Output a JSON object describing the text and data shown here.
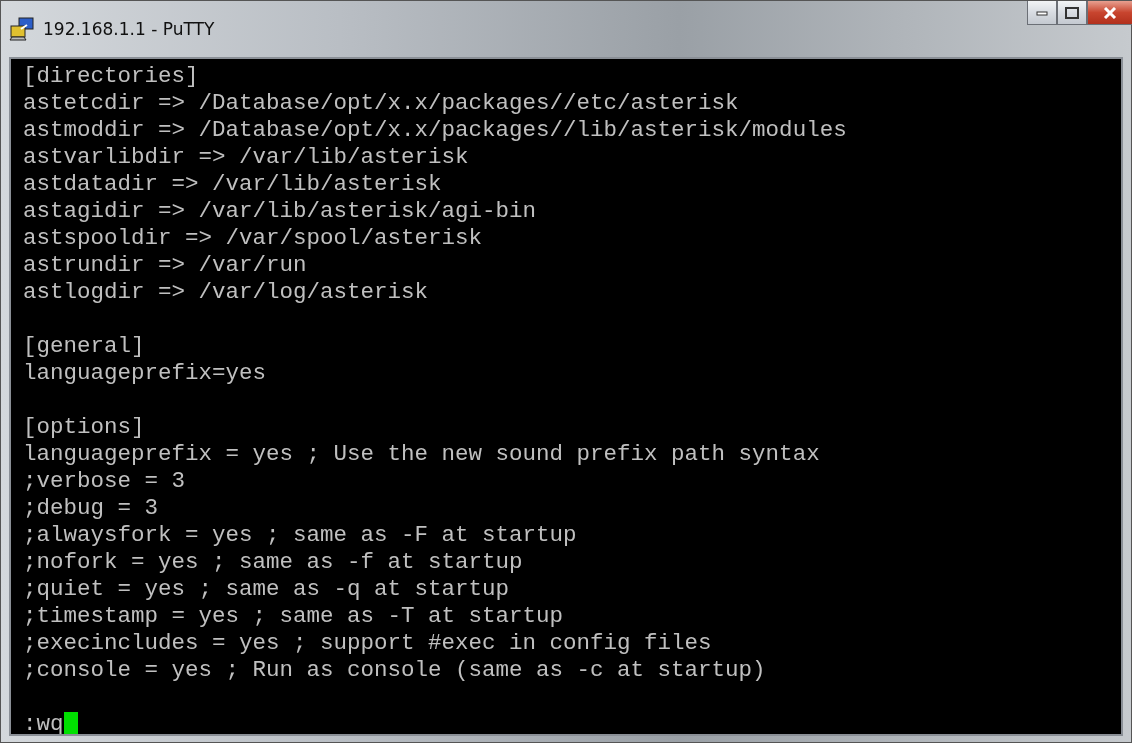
{
  "window": {
    "title": "192.168.1.1 - PuTTY"
  },
  "terminal": {
    "blocks": [
      [
        "[directories]",
        "astetcdir => /Database/opt/x.x/packages//etc/asterisk",
        "astmoddir => /Database/opt/x.x/packages//lib/asterisk/modules",
        "astvarlibdir => /var/lib/asterisk",
        "astdatadir => /var/lib/asterisk",
        "astagidir => /var/lib/asterisk/agi-bin",
        "astspooldir => /var/spool/asterisk",
        "astrundir => /var/run",
        "astlogdir => /var/log/asterisk"
      ],
      [
        "[general]",
        "languageprefix=yes"
      ],
      [
        "[options]",
        "languageprefix = yes ; Use the new sound prefix path syntax",
        ";verbose = 3",
        ";debug = 3",
        ";alwaysfork = yes ; same as -F at startup",
        ";nofork = yes ; same as -f at startup",
        ";quiet = yes ; same as -q at startup",
        ";timestamp = yes ; same as -T at startup",
        ";execincludes = yes ; support #exec in config files",
        ";console = yes ; Run as console (same as -c at startup)"
      ]
    ],
    "prompt": {
      "text": ":wq",
      "cursor": true
    }
  }
}
